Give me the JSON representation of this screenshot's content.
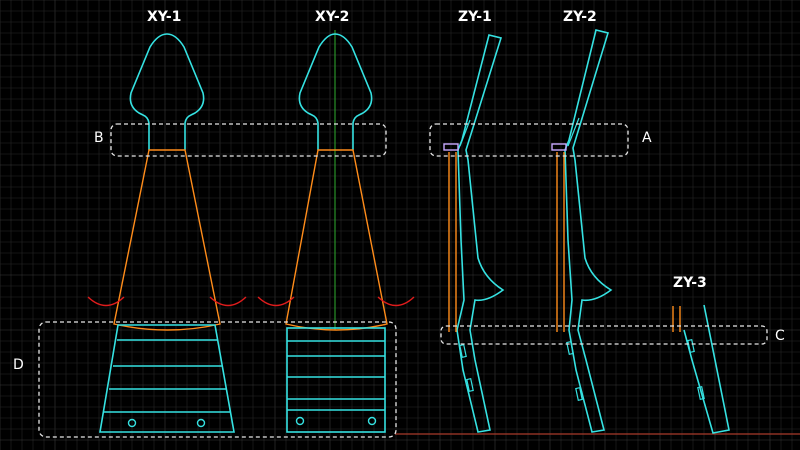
{
  "labels": {
    "xy1": "XY-1",
    "xy2": "XY-2",
    "zy1": "ZY-1",
    "zy2": "ZY-2",
    "zy3": "ZY-3",
    "box_a": "A",
    "box_b": "B",
    "box_c": "C",
    "box_d": "D"
  },
  "colors": {
    "background": "#000000",
    "grid": "#262626",
    "grid_major": "#3a3a3a",
    "outline": "#35e2e2",
    "taper": "#ff8c1a",
    "arc": "#e01c1c",
    "centerline": "#2fae2f",
    "groundline": "#a83a2a",
    "dashed_box": "#e6e6e6",
    "clip": "#c8a8ff"
  }
}
